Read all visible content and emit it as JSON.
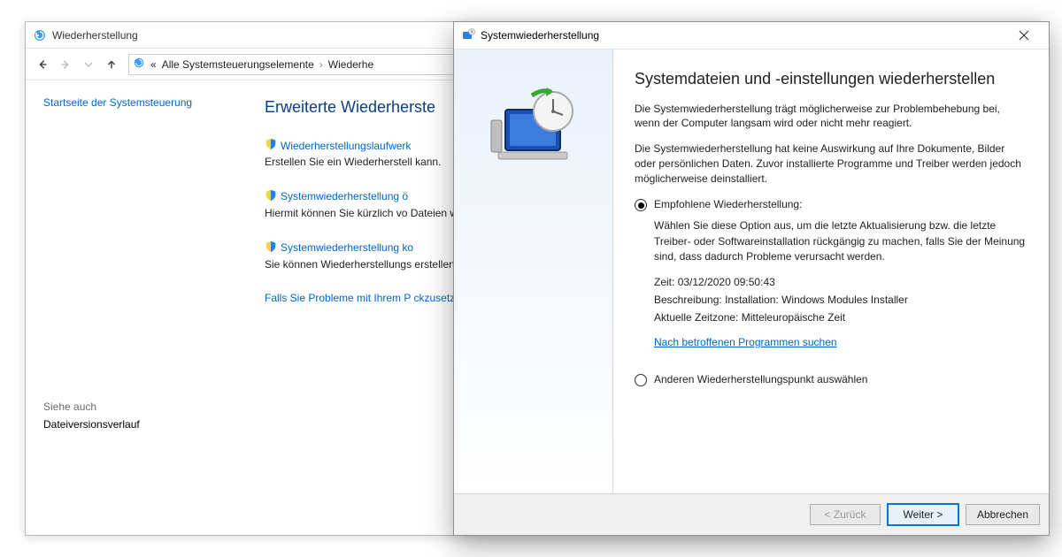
{
  "cp": {
    "title": "Wiederherstellung",
    "breadcrumb": {
      "overflow": "«",
      "item1": "Alle Systemsteuerungselemente",
      "item2": "Wiederhe"
    },
    "sidebar": {
      "home": "Startseite der Systemsteuerung",
      "seeAlsoLabel": "Siehe auch",
      "seeAlso1": "Dateiversionsverlauf"
    },
    "heading": "Erweiterte Wiederherste",
    "items": [
      {
        "title": "Wiederherstellungslaufwerk",
        "desc": "Erstellen Sie ein Wiederherstell kann."
      },
      {
        "title": "Systemwiederherstellung ö",
        "desc": "Hiermit können Sie kürzlich vo Dateien wie Dokumente, Bilde"
      },
      {
        "title": "Systemwiederherstellung ko",
        "desc": "Sie können Wiederherstellungs erstellen oder löschen."
      }
    ],
    "footerLink": "Falls Sie Probleme mit Ihrem P ckzusetzen."
  },
  "sr": {
    "title": "Systemwiederherstellung",
    "heading": "Systemdateien und -einstellungen wiederherstellen",
    "p1": "Die Systemwiederherstellung trägt möglicherweise zur Problembehebung bei, wenn der Computer langsam wird oder nicht mehr reagiert.",
    "p2": "Die Systemwiederherstellung hat keine Auswirkung auf Ihre Dokumente, Bilder oder persönlichen Daten. Zuvor installierte Programme und Treiber werden jedoch möglicherweise deinstalliert.",
    "opt1": {
      "label": "Empfohlene Wiederherstellung:",
      "desc": "Wählen Sie diese Option aus, um die letzte Aktualisierung bzw. die letzte Treiber- oder Softwareinstallation rückgängig zu machen, falls Sie der Meinung sind, dass dadurch Probleme verursacht werden.",
      "timeLabel": "Zeit:",
      "timeValue": "03/12/2020 09:50:43",
      "descLabel": "Beschreibung:",
      "descValue": "Installation: Windows Modules Installer",
      "tzLabel": "Aktuelle Zeitzone:",
      "tzValue": "Mitteleuropäische Zeit",
      "link": "Nach betroffenen Programmen suchen"
    },
    "opt2": {
      "label": "Anderen Wiederherstellungspunkt auswählen"
    },
    "buttons": {
      "back": "< Zurück",
      "next": "Weiter >",
      "cancel": "Abbrechen"
    }
  }
}
